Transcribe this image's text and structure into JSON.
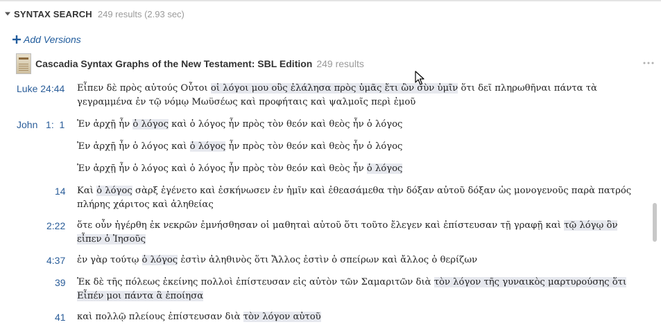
{
  "section": {
    "title": "SYNTAX SEARCH",
    "meta": "249 results (2.93 sec)"
  },
  "add_versions": "Add Versions",
  "resource": {
    "title": "Cascadia Syntax Graphs of the New Testament: SBL Edition",
    "count": "249 results"
  },
  "icons": {
    "collapse": "triangle-down-icon",
    "add": "plus-icon",
    "more": "more-dots-icon",
    "cursor": "mouse-pointer-icon"
  },
  "colors": {
    "link": "#2a5d99",
    "highlight": "#e6e8ee",
    "muted": "#9a9a9a"
  },
  "results": [
    {
      "ref": "Luke 24:44",
      "segments": [
        {
          "t": "Εἶπεν δὲ πρὸς αὐτούς Οὗτοι ",
          "h": false
        },
        {
          "t": "οἱ λόγοι μου οὓς ἐλάλησα πρὸς ὑμᾶς ἔτι ὢν σὺν ὑμῖν",
          "h": true
        },
        {
          "t": " ὅτι δεῖ πληρωθῆναι πάντα τὰ γεγραμμένα ἐν τῷ νόμῳ Μωϋσέως καὶ προφήταις καὶ ψαλμοῖς περὶ ἐμοῦ",
          "h": false
        }
      ]
    },
    {
      "ref": "John   1:  1",
      "segments": [
        {
          "t": "Ἐν ἀρχῇ ἦν ",
          "h": false
        },
        {
          "t": "ὁ λόγος",
          "h": true
        },
        {
          "t": " καὶ ὁ λόγος ἦν πρὸς τὸν θεόν καὶ θεὸς ἦν ὁ λόγος",
          "h": false
        }
      ]
    },
    {
      "ref": "",
      "segments": [
        {
          "t": "Ἐν ἀρχῇ ἦν ὁ λόγος καὶ ",
          "h": false
        },
        {
          "t": "ὁ λόγος",
          "h": true
        },
        {
          "t": " ἦν πρὸς τὸν θεόν καὶ θεὸς ἦν ὁ λόγος",
          "h": false
        }
      ]
    },
    {
      "ref": "",
      "segments": [
        {
          "t": "Ἐν ἀρχῇ ἦν ὁ λόγος καὶ ὁ λόγος ἦν πρὸς τὸν θεόν καὶ θεὸς ἦν ",
          "h": false
        },
        {
          "t": "ὁ λόγος",
          "h": true
        }
      ]
    },
    {
      "ref": "14",
      "segments": [
        {
          "t": "Καὶ ",
          "h": false
        },
        {
          "t": "ὁ λόγος",
          "h": true
        },
        {
          "t": " σὰρξ ἐγένετο καὶ ἐσκήνωσεν ἐν ἡμῖν καὶ ἐθεασάμεθα τὴν δόξαν αὐτοῦ δόξαν ὡς μονογενοῦς παρὰ πατρός πλήρης χάριτος καὶ ἀληθείας",
          "h": false
        }
      ]
    },
    {
      "ref": "2:22",
      "segments": [
        {
          "t": "ὅτε οὖν ἠγέρθη ἐκ νεκρῶν ἐμνήσθησαν οἱ μαθηταὶ αὐτοῦ ὅτι τοῦτο ἔλεγεν καὶ ἐπίστευσαν τῇ γραφῇ καὶ ",
          "h": false
        },
        {
          "t": "τῷ λόγῳ ὃν εἶπεν ὁ Ἰησοῦς",
          "h": true
        }
      ]
    },
    {
      "ref": "4:37",
      "segments": [
        {
          "t": "ἐν γὰρ τούτῳ ",
          "h": false
        },
        {
          "t": "ὁ λόγος",
          "h": true
        },
        {
          "t": " ἐστὶν ἀληθινὸς ὅτι Ἄλλος ἐστὶν ὁ σπείρων καὶ ἄλλος ὁ θερίζων",
          "h": false
        }
      ]
    },
    {
      "ref": "39",
      "segments": [
        {
          "t": "Ἐκ δὲ τῆς πόλεως ἐκείνης πολλοὶ ἐπίστευσαν εἰς αὐτὸν τῶν Σαμαριτῶν διὰ ",
          "h": false
        },
        {
          "t": "τὸν λόγον τῆς γυναικὸς μαρτυρούσης ὅτι Εἶπέν μοι πάντα ἃ ἐποίησα",
          "h": true
        }
      ]
    },
    {
      "ref": "41",
      "segments": [
        {
          "t": "καὶ πολλῷ πλείους ἐπίστευσαν διὰ ",
          "h": false
        },
        {
          "t": "τὸν λόγον αὐτοῦ",
          "h": true
        }
      ]
    }
  ]
}
